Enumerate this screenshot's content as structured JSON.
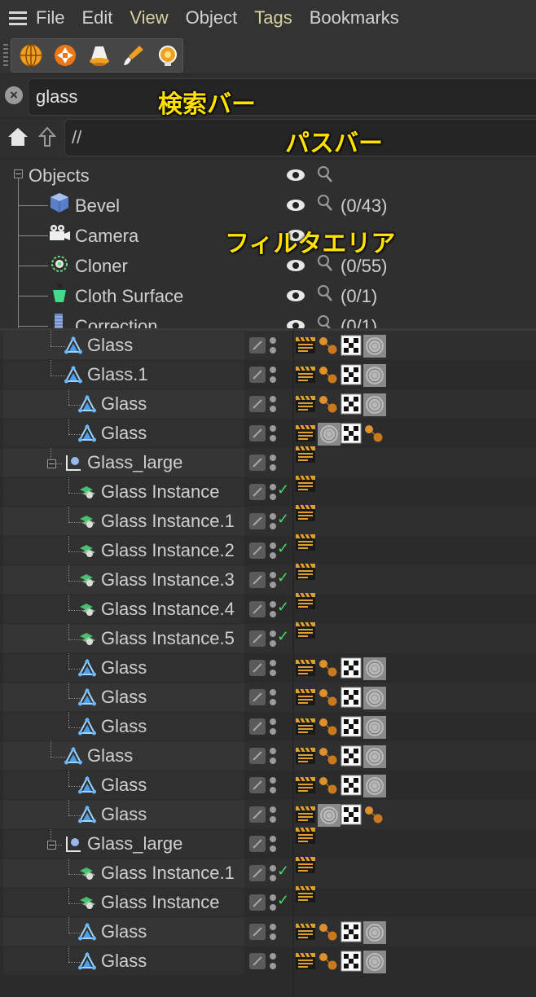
{
  "menubar": {
    "items": [
      {
        "label": "File",
        "hl": false
      },
      {
        "label": "Edit",
        "hl": false
      },
      {
        "label": "View",
        "hl": true
      },
      {
        "label": "Object",
        "hl": false
      },
      {
        "label": "Tags",
        "hl": true
      },
      {
        "label": "Bookmarks",
        "hl": false
      }
    ]
  },
  "toolbar": {
    "icons": [
      "globe-icon",
      "aperture-icon",
      "lamp-icon",
      "paintbrush-icon",
      "lightbulb-icon"
    ]
  },
  "search": {
    "value": "glass",
    "annotation": "検索バー"
  },
  "path": {
    "value": "//",
    "annotation": "パスバー"
  },
  "filter": {
    "annotation": "フィルタエリア",
    "root": {
      "label": "Objects"
    },
    "items": [
      {
        "label": "Bevel",
        "count": "(0/43)",
        "icon": "bevel-cube-icon"
      },
      {
        "label": "Camera",
        "count": "",
        "icon": "camera-icon"
      },
      {
        "label": "Cloner",
        "count": "(0/55)",
        "icon": "cloner-icon"
      },
      {
        "label": "Cloth Surface",
        "count": "(0/1)",
        "icon": "cloth-surface-icon"
      },
      {
        "label": "Correction",
        "count": "(0/1)",
        "icon": "correction-icon"
      }
    ]
  },
  "objects": [
    {
      "name": "Glass",
      "indent": 1,
      "type": "poly",
      "tags": [
        "clapper",
        "dots",
        "checker",
        "sphere"
      ],
      "check": false
    },
    {
      "name": "Glass.1",
      "indent": 1,
      "type": "poly",
      "tags": [
        "clapper",
        "dots",
        "checker",
        "sphere"
      ],
      "check": false
    },
    {
      "name": "Glass",
      "indent": 2,
      "type": "poly",
      "tags": [
        "clapper",
        "dots",
        "checker",
        "sphere"
      ],
      "check": false
    },
    {
      "name": "Glass",
      "indent": 2,
      "type": "poly",
      "tags": [
        "clapper",
        "sphere",
        "checker",
        "dots"
      ],
      "check": false
    },
    {
      "name": "Glass_large",
      "indent": 1,
      "type": "null",
      "tags": [
        "clapper"
      ],
      "check": false,
      "collapse": true
    },
    {
      "name": "Glass Instance",
      "indent": 2,
      "type": "instance",
      "tags": [
        "clapper"
      ],
      "check": true
    },
    {
      "name": "Glass Instance.1",
      "indent": 2,
      "type": "instance",
      "tags": [
        "clapper"
      ],
      "check": true
    },
    {
      "name": "Glass Instance.2",
      "indent": 2,
      "type": "instance",
      "tags": [
        "clapper"
      ],
      "check": true
    },
    {
      "name": "Glass Instance.3",
      "indent": 2,
      "type": "instance",
      "tags": [
        "clapper"
      ],
      "check": true
    },
    {
      "name": "Glass Instance.4",
      "indent": 2,
      "type": "instance",
      "tags": [
        "clapper"
      ],
      "check": true
    },
    {
      "name": "Glass Instance.5",
      "indent": 2,
      "type": "instance",
      "tags": [
        "clapper"
      ],
      "check": true
    },
    {
      "name": "Glass",
      "indent": 2,
      "type": "poly",
      "tags": [
        "clapper",
        "dots",
        "checker",
        "sphere"
      ],
      "check": false
    },
    {
      "name": "Glass",
      "indent": 2,
      "type": "poly",
      "tags": [
        "clapper",
        "dots",
        "checker",
        "sphere"
      ],
      "check": false
    },
    {
      "name": "Glass",
      "indent": 2,
      "type": "poly",
      "tags": [
        "clapper",
        "dots",
        "checker",
        "sphere"
      ],
      "check": false
    },
    {
      "name": "Glass",
      "indent": 1,
      "type": "poly",
      "tags": [
        "clapper",
        "dots",
        "checker",
        "sphere"
      ],
      "check": false
    },
    {
      "name": "Glass",
      "indent": 2,
      "type": "poly",
      "tags": [
        "clapper",
        "dots",
        "checker",
        "sphere"
      ],
      "check": false
    },
    {
      "name": "Glass",
      "indent": 2,
      "type": "poly",
      "tags": [
        "clapper",
        "sphere",
        "checker",
        "dots"
      ],
      "check": false
    },
    {
      "name": "Glass_large",
      "indent": 1,
      "type": "null",
      "tags": [
        "clapper"
      ],
      "check": false,
      "collapse": true
    },
    {
      "name": "Glass Instance.1",
      "indent": 2,
      "type": "instance",
      "tags": [
        "clapper"
      ],
      "check": true
    },
    {
      "name": "Glass Instance",
      "indent": 2,
      "type": "instance",
      "tags": [
        "clapper"
      ],
      "check": true
    },
    {
      "name": "Glass",
      "indent": 2,
      "type": "poly",
      "tags": [
        "clapper",
        "dots",
        "checker",
        "sphere"
      ],
      "check": false
    },
    {
      "name": "Glass",
      "indent": 2,
      "type": "poly",
      "tags": [
        "clapper",
        "dots",
        "checker",
        "sphere"
      ],
      "check": false
    }
  ]
}
